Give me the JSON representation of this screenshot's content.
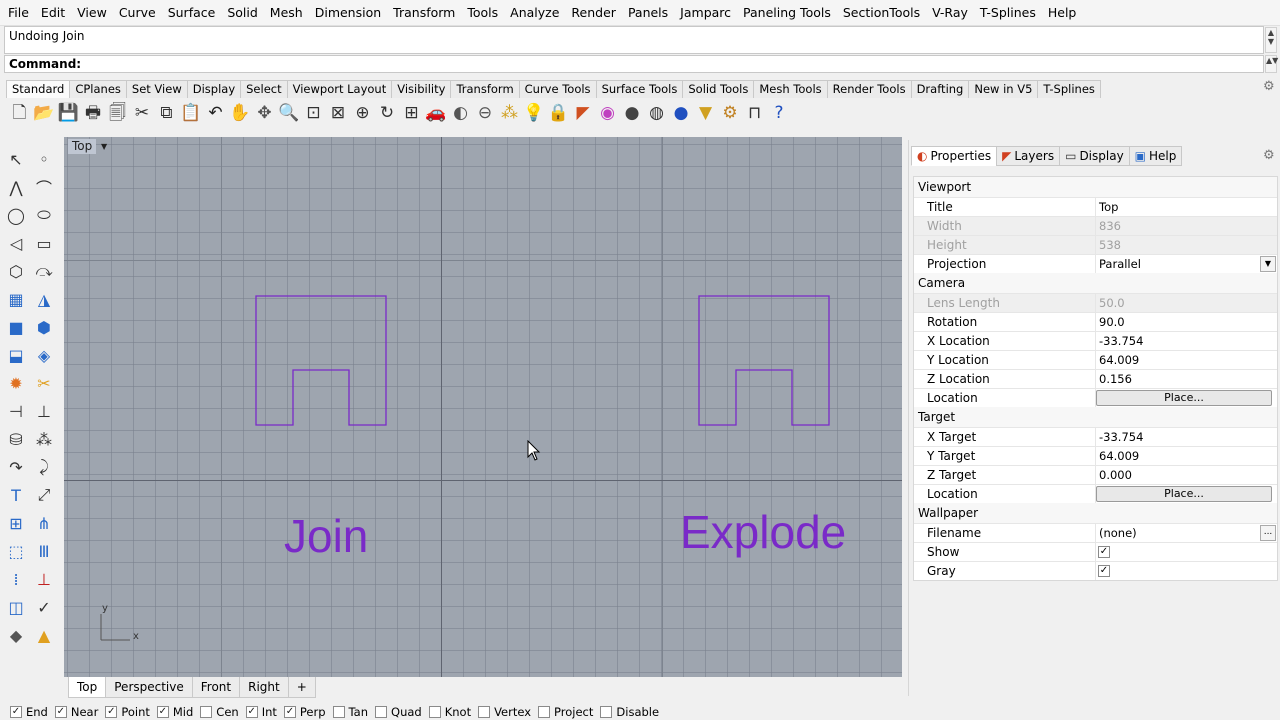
{
  "menu": [
    "File",
    "Edit",
    "View",
    "Curve",
    "Surface",
    "Solid",
    "Mesh",
    "Dimension",
    "Transform",
    "Tools",
    "Analyze",
    "Render",
    "Panels",
    "Jamparc",
    "Paneling Tools",
    "SectionTools",
    "V-Ray",
    "T-Splines",
    "Help"
  ],
  "history": "Undoing Join",
  "command_label": "Command:",
  "toolbar_tabs": [
    "Standard",
    "CPlanes",
    "Set View",
    "Display",
    "Select",
    "Viewport Layout",
    "Visibility",
    "Transform",
    "Curve Tools",
    "Surface Tools",
    "Solid Tools",
    "Mesh Tools",
    "Render Tools",
    "Drafting",
    "New in V5",
    "T-Splines"
  ],
  "toolbar_icons": [
    {
      "name": "new-icon",
      "glyph": "🗋",
      "color": "#333"
    },
    {
      "name": "open-icon",
      "glyph": "📂",
      "color": "#c8a020"
    },
    {
      "name": "save-icon",
      "glyph": "💾",
      "color": "#333"
    },
    {
      "name": "print-icon",
      "glyph": "🖶",
      "color": "#333"
    },
    {
      "name": "copy-file-icon",
      "glyph": "🗐",
      "color": "#333"
    },
    {
      "name": "cut-icon",
      "glyph": "✂",
      "color": "#333"
    },
    {
      "name": "copy-icon",
      "glyph": "⧉",
      "color": "#333"
    },
    {
      "name": "paste-icon",
      "glyph": "📋",
      "color": "#c8a020"
    },
    {
      "name": "undo-icon",
      "glyph": "↶",
      "color": "#222"
    },
    {
      "name": "pan-hand-icon",
      "glyph": "✋",
      "color": "#333"
    },
    {
      "name": "move-view-icon",
      "glyph": "✥",
      "color": "#555"
    },
    {
      "name": "zoom-icon",
      "glyph": "🔍",
      "color": "#333"
    },
    {
      "name": "zoom-window-icon",
      "glyph": "⊡",
      "color": "#333"
    },
    {
      "name": "zoom-extents-icon",
      "glyph": "⊠",
      "color": "#333"
    },
    {
      "name": "zoom-selected-icon",
      "glyph": "⊕",
      "color": "#333"
    },
    {
      "name": "rotate-view-icon",
      "glyph": "↻",
      "color": "#333"
    },
    {
      "name": "four-views-icon",
      "glyph": "⊞",
      "color": "#333"
    },
    {
      "name": "car-icon",
      "glyph": "🚗",
      "color": "#c02020"
    },
    {
      "name": "named-view-icon",
      "glyph": "◐",
      "color": "#555"
    },
    {
      "name": "cplane-icon",
      "glyph": "⊖",
      "color": "#555"
    },
    {
      "name": "select-points-icon",
      "glyph": "⁂",
      "color": "#d0a020"
    },
    {
      "name": "light-bulb-icon",
      "glyph": "💡",
      "color": "#999"
    },
    {
      "name": "lock-icon",
      "glyph": "🔒",
      "color": "#333"
    },
    {
      "name": "layer-icon",
      "glyph": "◤",
      "color": "#d05020"
    },
    {
      "name": "color-wheel-icon",
      "glyph": "◉",
      "color": "#c040c0"
    },
    {
      "name": "shade-sphere-icon",
      "glyph": "●",
      "color": "#444"
    },
    {
      "name": "render-sphere-icon",
      "glyph": "◍",
      "color": "#333"
    },
    {
      "name": "blue-sphere-icon",
      "glyph": "●",
      "color": "#2050c0"
    },
    {
      "name": "light-icon",
      "glyph": "▼",
      "color": "#d0a020"
    },
    {
      "name": "options-gear-icon",
      "glyph": "⚙",
      "color": "#c08020"
    },
    {
      "name": "dimension-icon",
      "glyph": "⊓",
      "color": "#333"
    },
    {
      "name": "help-icon",
      "glyph": "?",
      "color": "#2050c0"
    }
  ],
  "left_tools": [
    [
      {
        "name": "select-arrow-icon",
        "glyph": "↖",
        "color": "#333"
      },
      {
        "name": "point-icon",
        "glyph": "◦",
        "color": "#333"
      }
    ],
    [
      {
        "name": "polyline-icon",
        "glyph": "⋀",
        "color": "#333"
      },
      {
        "name": "curve-cv-icon",
        "glyph": "⌒",
        "color": "#333"
      }
    ],
    [
      {
        "name": "circle-icon",
        "glyph": "◯",
        "color": "#333"
      },
      {
        "name": "ellipse-icon",
        "glyph": "⬭",
        "color": "#333"
      }
    ],
    [
      {
        "name": "arc-icon",
        "glyph": "◁",
        "color": "#333"
      },
      {
        "name": "rectangle-icon",
        "glyph": "▭",
        "color": "#333"
      }
    ],
    [
      {
        "name": "polygon-icon",
        "glyph": "⬡",
        "color": "#333"
      },
      {
        "name": "freeform-curve-icon",
        "glyph": "⤼",
        "color": "#333"
      }
    ],
    [
      {
        "name": "surface-points-icon",
        "glyph": "▦",
        "color": "#2a6ac8"
      },
      {
        "name": "extrude-curve-icon",
        "glyph": "◮",
        "color": "#2a6ac8"
      }
    ],
    [
      {
        "name": "box-icon",
        "glyph": "■",
        "color": "#2a6ac8"
      },
      {
        "name": "sphere-group-icon",
        "glyph": "⬢",
        "color": "#2a6ac8"
      }
    ],
    [
      {
        "name": "cylinder-icon",
        "glyph": "⬓",
        "color": "#2a6ac8"
      },
      {
        "name": "mesh-plane-icon",
        "glyph": "◈",
        "color": "#2a6ac8"
      }
    ],
    [
      {
        "name": "explode-icon",
        "glyph": "✹",
        "color": "#e07020"
      },
      {
        "name": "trim-icon",
        "glyph": "✂",
        "color": "#e0a020"
      }
    ],
    [
      {
        "name": "split-icon",
        "glyph": "⊣",
        "color": "#333"
      },
      {
        "name": "extend-icon",
        "glyph": "⊥",
        "color": "#333"
      }
    ],
    [
      {
        "name": "boolean-union-icon",
        "glyph": "⛁",
        "color": "#333"
      },
      {
        "name": "group-icon",
        "glyph": "⁂",
        "color": "#333"
      }
    ],
    [
      {
        "name": "fillet-icon",
        "glyph": "↷",
        "color": "#333"
      },
      {
        "name": "chamfer-icon",
        "glyph": "⤸",
        "color": "#333"
      }
    ],
    [
      {
        "name": "text-icon",
        "glyph": "T",
        "color": "#2a6ac8"
      },
      {
        "name": "dimension-left-icon",
        "glyph": "⤢",
        "color": "#333"
      }
    ],
    [
      {
        "name": "array-icon",
        "glyph": "⊞",
        "color": "#2a6ac8"
      },
      {
        "name": "mirror-icon",
        "glyph": "⋔",
        "color": "#2a6ac8"
      }
    ],
    [
      {
        "name": "cube-outline-icon",
        "glyph": "⬚",
        "color": "#2a6ac8"
      },
      {
        "name": "grid-bars-icon",
        "glyph": "Ⅲ",
        "color": "#2a6ac8"
      }
    ],
    [
      {
        "name": "dot-grid-icon",
        "glyph": "⁞",
        "color": "#2a6ac8"
      },
      {
        "name": "cage-edit-icon",
        "glyph": "⊥",
        "color": "#c02020"
      }
    ],
    [
      {
        "name": "scale-icon",
        "glyph": "◫",
        "color": "#2a6ac8"
      },
      {
        "name": "check-icon",
        "glyph": "✓",
        "color": "#333"
      }
    ],
    [
      {
        "name": "render-object-icon",
        "glyph": "◆",
        "color": "#555"
      },
      {
        "name": "material-cone-icon",
        "glyph": "▲",
        "color": "#e0a020"
      }
    ]
  ],
  "viewport": {
    "title": "Top",
    "labels": {
      "join": "Join",
      "explode": "Explode"
    },
    "axis_x": "x",
    "axis_y": "y",
    "shape_color": "#7a2ac8"
  },
  "viewport_tabs": [
    "Top",
    "Perspective",
    "Front",
    "Right",
    "+"
  ],
  "osnaps": [
    {
      "label": "End",
      "checked": true
    },
    {
      "label": "Near",
      "checked": true
    },
    {
      "label": "Point",
      "checked": true
    },
    {
      "label": "Mid",
      "checked": true
    },
    {
      "label": "Cen",
      "checked": false
    },
    {
      "label": "Int",
      "checked": true
    },
    {
      "label": "Perp",
      "checked": true
    },
    {
      "label": "Tan",
      "checked": false
    },
    {
      "label": "Quad",
      "checked": false
    },
    {
      "label": "Knot",
      "checked": false
    },
    {
      "label": "Vertex",
      "checked": false
    },
    {
      "label": "Project",
      "checked": false
    },
    {
      "label": "Disable",
      "checked": false
    }
  ],
  "panel": {
    "tabs": [
      {
        "label": "Properties",
        "icon": "properties-icon",
        "glyph": "◐",
        "color": "#d04020",
        "active": true
      },
      {
        "label": "Layers",
        "icon": "layers-icon",
        "glyph": "◤",
        "color": "#d04020",
        "active": false
      },
      {
        "label": "Display",
        "icon": "display-icon",
        "glyph": "▭",
        "color": "#333",
        "active": false
      },
      {
        "label": "Help",
        "icon": "help-panel-icon",
        "glyph": "▣",
        "color": "#2a6ac8",
        "active": false
      }
    ],
    "sections": {
      "viewport": "Viewport",
      "camera": "Camera",
      "target": "Target",
      "wallpaper": "Wallpaper"
    },
    "viewport_rows": [
      {
        "key": "Title",
        "value": "Top",
        "disabled": false
      },
      {
        "key": "Width",
        "value": "836",
        "disabled": true
      },
      {
        "key": "Height",
        "value": "538",
        "disabled": true
      },
      {
        "key": "Projection",
        "value": "Parallel",
        "disabled": false
      }
    ],
    "camera_rows": [
      {
        "key": "Lens Length",
        "value": "50.0",
        "disabled": true
      },
      {
        "key": "Rotation",
        "value": "90.0",
        "disabled": false
      },
      {
        "key": "X Location",
        "value": "-33.754",
        "disabled": false
      },
      {
        "key": "Y Location",
        "value": "64.009",
        "disabled": false
      },
      {
        "key": "Z Location",
        "value": "0.156",
        "disabled": false
      },
      {
        "key": "Location",
        "value": "Place...",
        "disabled": false
      }
    ],
    "target_rows": [
      {
        "key": "X Target",
        "value": "-33.754",
        "disabled": false
      },
      {
        "key": "Y Target",
        "value": "64.009",
        "disabled": false
      },
      {
        "key": "Z Target",
        "value": "0.000",
        "disabled": false
      },
      {
        "key": "Location",
        "value": "Place...",
        "disabled": false
      }
    ],
    "wallpaper_rows": [
      {
        "key": "Filename",
        "value": "(none)",
        "disabled": false
      },
      {
        "key": "Show",
        "value": "",
        "checked": true,
        "disabled": false
      },
      {
        "key": "Gray",
        "value": "",
        "checked": true,
        "disabled": false
      }
    ]
  }
}
